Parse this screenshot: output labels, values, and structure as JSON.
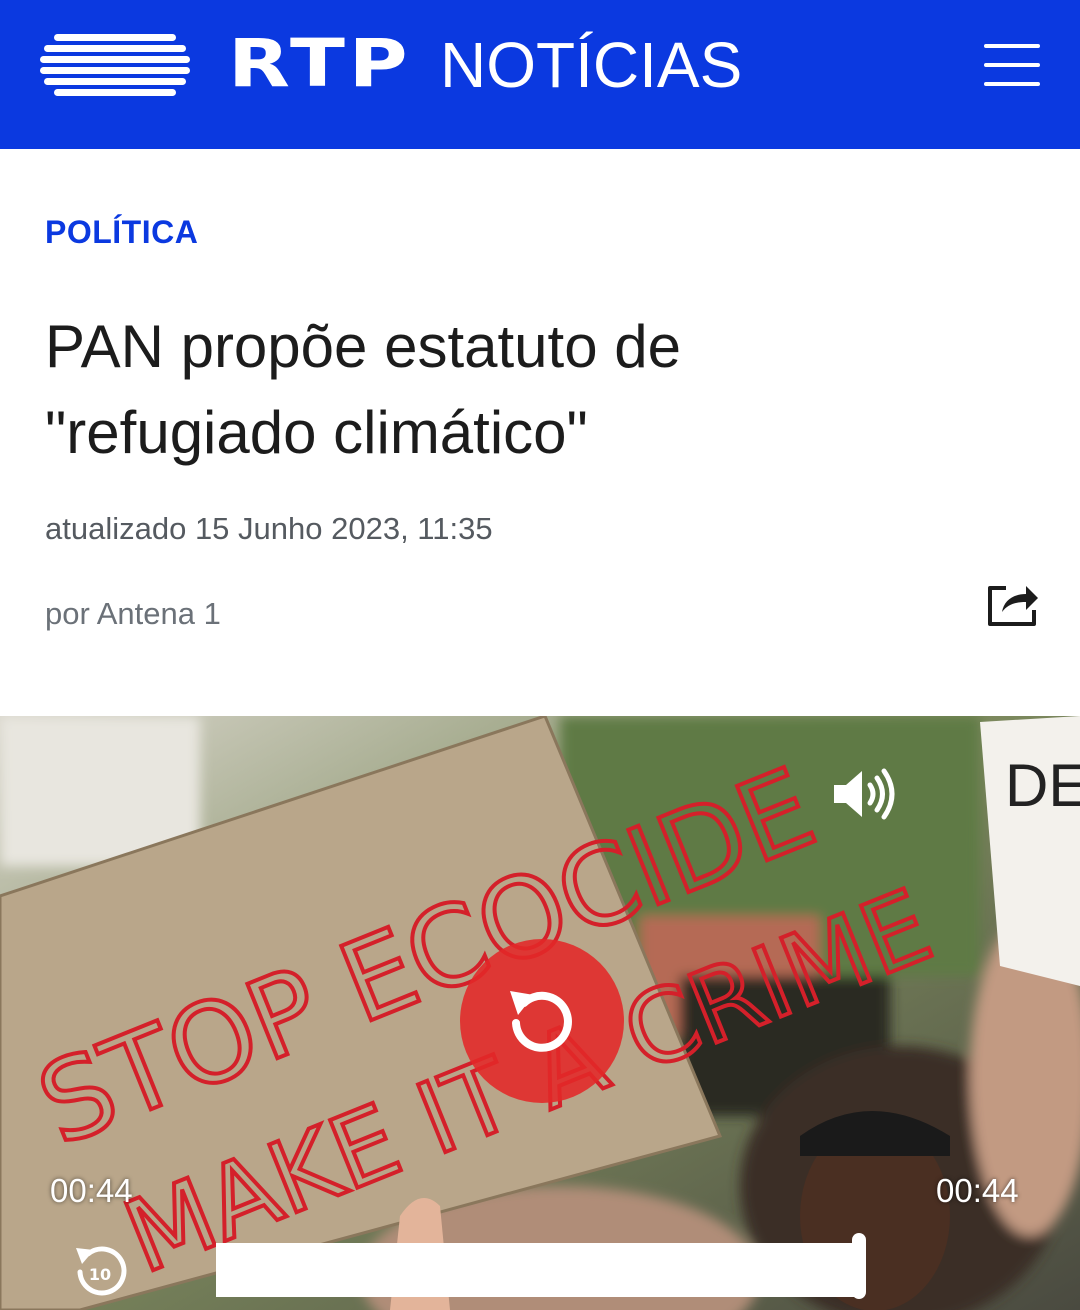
{
  "header": {
    "brand": "RTP",
    "section": "NOTÍCIAS",
    "menu_icon": "hamburger-menu-icon",
    "background_color": "#0b39e0"
  },
  "article": {
    "category": "POLÍTICA",
    "title_line1": "PAN propõe estatuto de",
    "title_line2": "\"refugiado climático\"",
    "updated": "atualizado 15 Junho 2023, 11:35",
    "author": "por Antena 1",
    "share_icon": "share-icon"
  },
  "video": {
    "sign_text_line1": "STOP ECOCIDE",
    "sign_text_line2": "MAKE IT A CRIME",
    "current_time": "00:44",
    "duration": "00:44",
    "progress": 1.0,
    "rewind_seconds": "10",
    "volume_icon": "volume-icon",
    "replay_icon": "replay-icon",
    "replay_color": "#e22828"
  }
}
